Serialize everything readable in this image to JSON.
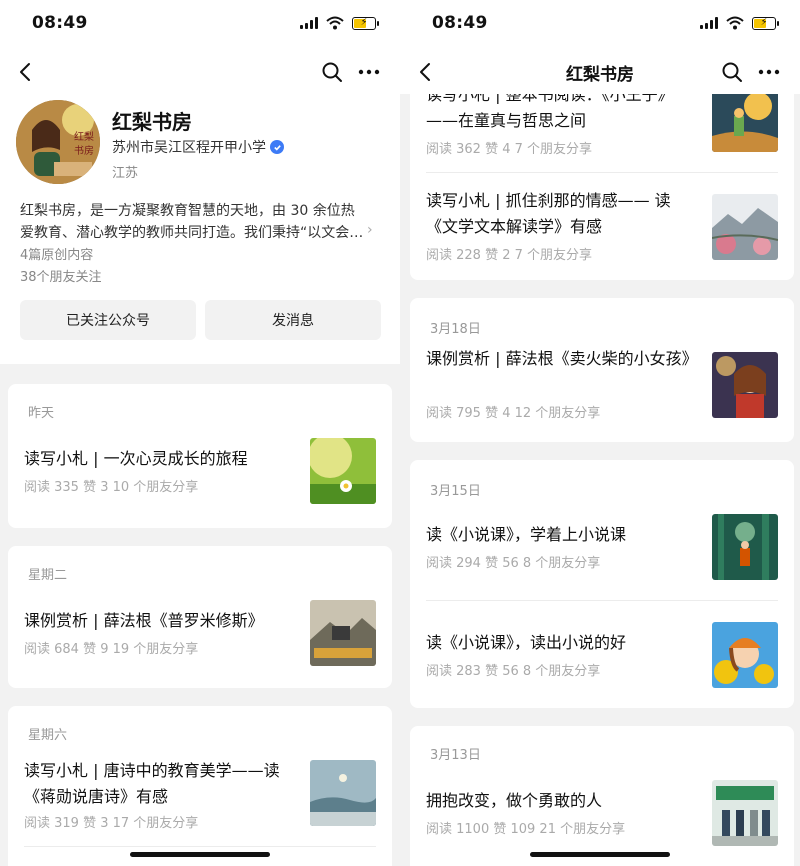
{
  "status": {
    "time": "08:49"
  },
  "left": {
    "account": {
      "name": "红梨书房",
      "org": "苏州市吴江区程开甲小学",
      "location": "江苏",
      "avatar_text": "红梨书房",
      "description": "红梨书房，是一方凝聚教育智慧的天地，由 30 余位热爱教育、潜心教学的教师共同打造。我们秉持“以文会…",
      "original_count": "4篇原创内容",
      "followers": "38个朋友关注"
    },
    "buttons": {
      "follow": "已关注公众号",
      "message": "发消息"
    },
    "groups": [
      {
        "date": "昨天",
        "articles": [
          {
            "title": "读写小札 | 一次心灵成长的旅程",
            "meta": "阅读 335   赞 3   10 个朋友分享"
          }
        ]
      },
      {
        "date": "星期二",
        "articles": [
          {
            "title": "课例赏析 | 薛法根《普罗米修斯》",
            "meta": "阅读 684   赞 9   19 个朋友分享"
          }
        ]
      },
      {
        "date": "星期六",
        "articles": [
          {
            "title": "读写小札 | 唐诗中的教育美学——读《蒋勋说唐诗》有感",
            "meta": "阅读 319   赞 3   17 个朋友分享"
          }
        ]
      }
    ]
  },
  "right": {
    "nav_title": "红梨书房",
    "top_articles": [
      {
        "title": "读写小札 | 整本书阅读：《小王子》——在童真与哲思之间",
        "meta": "阅读 362   赞 4   7 个朋友分享"
      },
      {
        "title": "读写小札 | 抓住刹那的情感—— 读《文学文本解读学》有感",
        "meta": "阅读 228   赞 2   7 个朋友分享"
      }
    ],
    "groups": [
      {
        "date": "3月18日",
        "articles": [
          {
            "title": "课例赏析 | 薛法根《卖火柴的小女孩》",
            "meta": "阅读 795   赞 4   12 个朋友分享"
          }
        ]
      },
      {
        "date": "3月15日",
        "articles": [
          {
            "title": "读《小说课》，学着上小说课",
            "meta": "阅读 294   赞 56   8 个朋友分享"
          },
          {
            "title": "读《小说课》，读出小说的好",
            "meta": "阅读 283   赞 56   8 个朋友分享"
          }
        ]
      },
      {
        "date": "3月13日",
        "articles": [
          {
            "title": "拥抱改变，做个勇敢的人",
            "meta": "阅读 1100   赞 109   21 个朋友分享"
          }
        ]
      }
    ]
  },
  "colors": {
    "background": "#f2f2f2",
    "card": "#ffffff",
    "verified": "#3d7bf6",
    "battery": "#f5c400"
  },
  "icons": [
    "back-icon",
    "search-icon",
    "more-icon",
    "signal-icon",
    "wifi-icon",
    "battery-icon",
    "verified-icon",
    "chevron-right-icon"
  ]
}
